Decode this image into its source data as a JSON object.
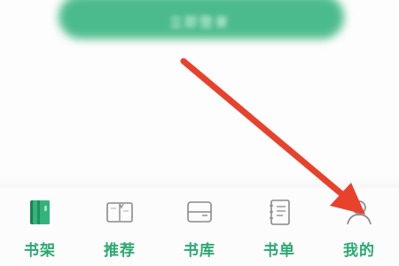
{
  "top_button": {
    "label": "立即登录"
  },
  "tabbar": {
    "tabs": [
      {
        "label": "书架",
        "icon": "bookshelf-icon"
      },
      {
        "label": "推荐",
        "icon": "book-open-icon"
      },
      {
        "label": "书库",
        "icon": "library-box-icon"
      },
      {
        "label": "书单",
        "icon": "booklist-notebook-icon"
      },
      {
        "label": "我的",
        "icon": "user-profile-icon"
      }
    ]
  },
  "colors": {
    "accent": "#2aa971",
    "pill": "#34b37c",
    "arrow": "#e8412c",
    "icon_gray": "#8a8a8a"
  }
}
